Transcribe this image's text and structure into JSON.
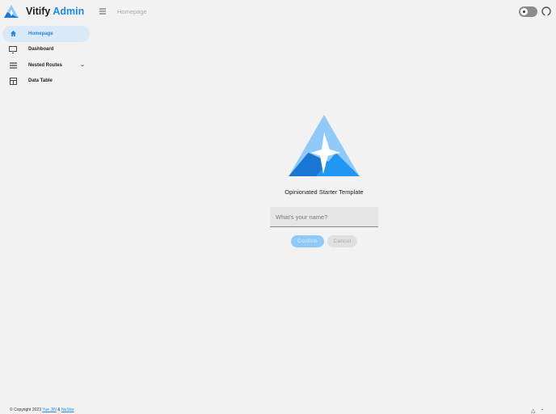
{
  "header": {
    "brand_first": "Vitify",
    "brand_second": "Admin",
    "breadcrumb": "Homepage"
  },
  "sidebar": {
    "items": [
      {
        "label": "Homepage",
        "icon": "home-icon"
      },
      {
        "label": "Dashboard",
        "icon": "monitor-dashboard-icon"
      },
      {
        "label": "Nested Routes",
        "icon": "list-icon"
      },
      {
        "label": "Data Table",
        "icon": "table-icon"
      }
    ]
  },
  "main": {
    "tagline": "Opinionated Starter Template",
    "name_placeholder": "What's your name?",
    "confirm_label": "Confirm",
    "cancel_label": "Cancel"
  },
  "footer": {
    "copyright": "© Copyright 2023",
    "author1": "Yue JIN",
    "amp": "&",
    "author2": "NuStar"
  },
  "colors": {
    "accent": "#1e88e5"
  }
}
